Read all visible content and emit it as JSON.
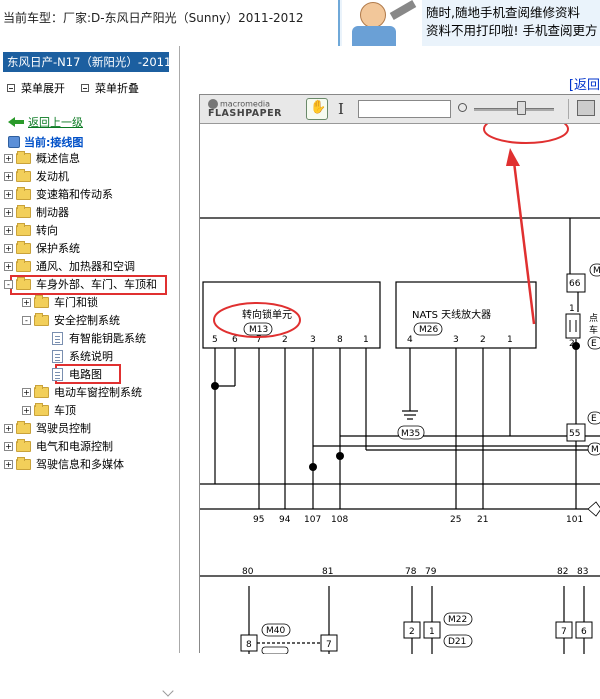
{
  "header": {
    "car_title": "当前车型：厂家:D-东风日产阳光（Sunny）2011-2012"
  },
  "ad": {
    "line1": "随时,随地手机查阅维修资料",
    "line2": "资料不用打印啦! 手机查阅更方"
  },
  "sidebar": {
    "model": "东风日产-N17（新阳光）-2011",
    "expand_label": "菜单展开",
    "collapse_label": "菜单折叠",
    "back_label": "返回上一级",
    "current_label": "当前:接线图",
    "items": [
      {
        "label": "概述信息",
        "sign": "+"
      },
      {
        "label": "发动机",
        "sign": "+"
      },
      {
        "label": "变速箱和传动系",
        "sign": "+"
      },
      {
        "label": "制动器",
        "sign": "+"
      },
      {
        "label": "转向",
        "sign": "+"
      },
      {
        "label": "保护系统",
        "sign": "+"
      },
      {
        "label": "通风、加热器和空调",
        "sign": "+"
      },
      {
        "label": "车身外部、车门、车顶和",
        "sign": "-"
      },
      {
        "label": "车门和锁",
        "sign": "+"
      },
      {
        "label": "安全控制系统",
        "sign": "-"
      },
      {
        "label": "有智能钥匙系统",
        "sign": ""
      },
      {
        "label": "系统说明",
        "sign": ""
      },
      {
        "label": "电路图",
        "sign": ""
      },
      {
        "label": "电动车窗控制系统",
        "sign": "+"
      },
      {
        "label": "车顶",
        "sign": "+"
      },
      {
        "label": "驾驶员控制",
        "sign": "+"
      },
      {
        "label": "电气和电源控制",
        "sign": "+"
      },
      {
        "label": "驾驶信息和多媒体",
        "sign": "+"
      }
    ]
  },
  "main": {
    "back_label": "[返回"
  },
  "viewer": {
    "logo_top": "macromedia",
    "logo_bottom": "FLASHPAPER",
    "search_value": "",
    "zoom_percent": 55
  },
  "diagram": {
    "box1_title": "转向锁单元",
    "box1_code": "M13",
    "box1_pins": [
      "5",
      "6",
      "7",
      "2",
      "3",
      "8",
      "1"
    ],
    "box2_title": "NATS 天线放大器",
    "box2_code": "M26",
    "box2_pins": [
      "4",
      "3",
      "2",
      "1"
    ],
    "ground_code": "M35",
    "bottom_numbers": [
      "95",
      "94",
      "107",
      "108",
      "25",
      "21",
      "101"
    ],
    "conn_top": [
      "80",
      "81",
      "78",
      "79",
      "82",
      "83"
    ],
    "connA": [
      "8",
      "7"
    ],
    "connA_codes": [
      "M40",
      "D2"
    ],
    "connB": [
      "2",
      "1"
    ],
    "connB_codes": [
      "M22",
      "D21"
    ],
    "connC": [
      "7",
      "6"
    ],
    "right_nums": [
      "66",
      "1",
      "2",
      "55"
    ],
    "right_letters": [
      "M",
      "E",
      "E",
      "M"
    ],
    "right_text": [
      "点",
      "车"
    ]
  },
  "colors": {
    "highlight": "#e03030",
    "sidebar_header": "#1c5fa0",
    "link_green": "#0a7a22",
    "link_blue": "#0050c8"
  }
}
